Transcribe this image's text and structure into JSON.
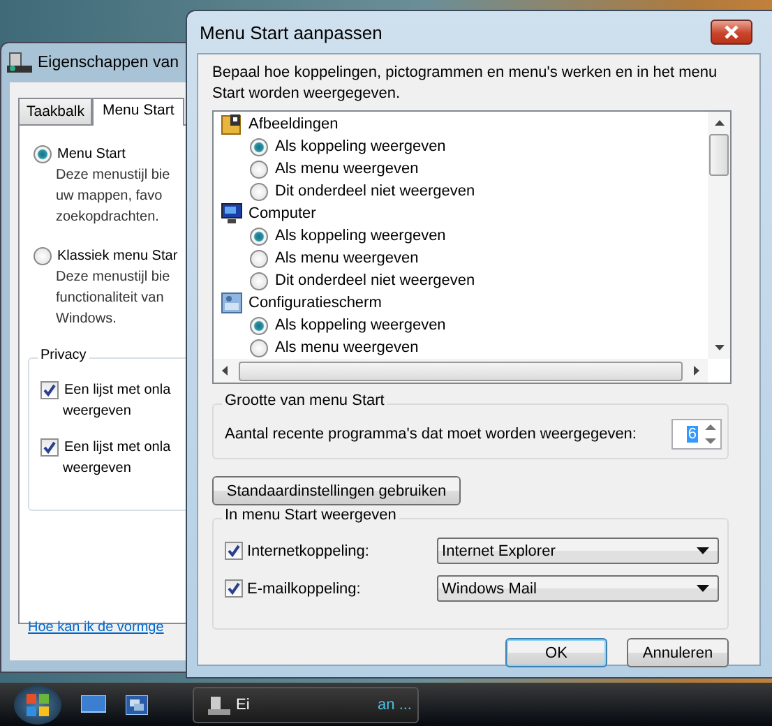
{
  "back_window": {
    "title": "Eigenschappen van",
    "tabs": [
      {
        "label": "Taakbalk",
        "selected": false
      },
      {
        "label": "Menu Start",
        "selected": true
      }
    ],
    "styles": [
      {
        "label": "Menu Start",
        "selected": true,
        "description": [
          "Deze menustijl bie",
          "uw mappen, favo",
          "zoekopdrachten."
        ]
      },
      {
        "label": "Klassiek menu Star",
        "selected": false,
        "description": [
          "Deze menustijl bie",
          "functionaliteit van",
          "Windows."
        ]
      }
    ],
    "privacy": {
      "title": "Privacy",
      "items": [
        {
          "lines": [
            "Een lijst met onla",
            "weergeven"
          ],
          "checked": true
        },
        {
          "lines": [
            "Een lijst met onla",
            "weergeven"
          ],
          "checked": true
        }
      ]
    },
    "help_link": "Hoe kan ik de vormge"
  },
  "dialog": {
    "title": "Menu Start aanpassen",
    "intro": "Bepaal hoe koppelingen, pictogrammen en menu's werken en in het menu Start worden weergegeven.",
    "tree": [
      {
        "label": "Afbeeldingen",
        "kind": "pictures",
        "children": [
          {
            "label": "Als koppeling weergeven",
            "selected": true
          },
          {
            "label": "Als menu weergeven",
            "selected": false
          },
          {
            "label": "Dit onderdeel niet weergeven",
            "selected": false
          }
        ]
      },
      {
        "label": "Computer",
        "kind": "computer",
        "children": [
          {
            "label": "Als koppeling weergeven",
            "selected": true
          },
          {
            "label": "Als menu weergeven",
            "selected": false
          },
          {
            "label": "Dit onderdeel niet weergeven",
            "selected": false
          }
        ]
      },
      {
        "label": "Configuratiescherm",
        "kind": "control-panel",
        "children": [
          {
            "label": "Als koppeling weergeven",
            "selected": true
          },
          {
            "label": "Als menu weergeven",
            "selected": false
          }
        ]
      }
    ],
    "size_group": {
      "title": "Grootte van menu Start",
      "label": "Aantal recente programma's dat moet worden weergegeven:",
      "value": "6"
    },
    "defaults_button": "Standaardinstellingen gebruiken",
    "show_group": {
      "title": "In menu Start weergeven",
      "rows": [
        {
          "label": "Internetkoppeling:",
          "checked": true,
          "value": "Internet Explorer"
        },
        {
          "label": "E-mailkoppeling:",
          "checked": true,
          "value": "Windows Mail"
        }
      ]
    },
    "buttons": [
      {
        "label": "OK",
        "kind": "default"
      },
      {
        "label": "Annuleren",
        "kind": "normal"
      }
    ]
  },
  "taskbar": {
    "task_texts": [
      "Ei",
      "an ..."
    ]
  }
}
